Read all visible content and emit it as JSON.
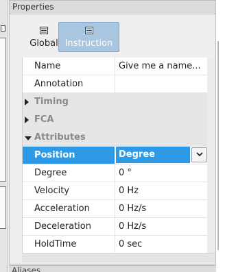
{
  "panel": {
    "title": "Properties"
  },
  "tabs": [
    {
      "label": "Global",
      "icon": "list-icon",
      "selected": false
    },
    {
      "label": "Instruction",
      "icon": "list-icon",
      "selected": true
    }
  ],
  "properties": {
    "name": {
      "label": "Name",
      "value": "Give me a name..."
    },
    "annotation": {
      "label": "Annotation",
      "value": ""
    },
    "groups": {
      "timing": "Timing",
      "fca": "FCA",
      "attributes": "Attributes"
    },
    "attributes": {
      "position": {
        "label": "Position",
        "value": "Degree"
      },
      "degree": {
        "label": "Degree",
        "value": "0 °"
      },
      "velocity": {
        "label": "Velocity",
        "value": "0 Hz"
      },
      "acceleration": {
        "label": "Acceleration",
        "value": "0 Hz/s"
      },
      "deceleration": {
        "label": "Deceleration",
        "value": "0 Hz/s"
      },
      "holdtime": {
        "label": "HoldTime",
        "value": "0 sec"
      }
    }
  },
  "bottom_dock": {
    "title": "Aliases"
  },
  "colors": {
    "selection": "#2e9ae6",
    "tab_selected": "#a8c6df",
    "group_background": "#e6e6e6"
  }
}
